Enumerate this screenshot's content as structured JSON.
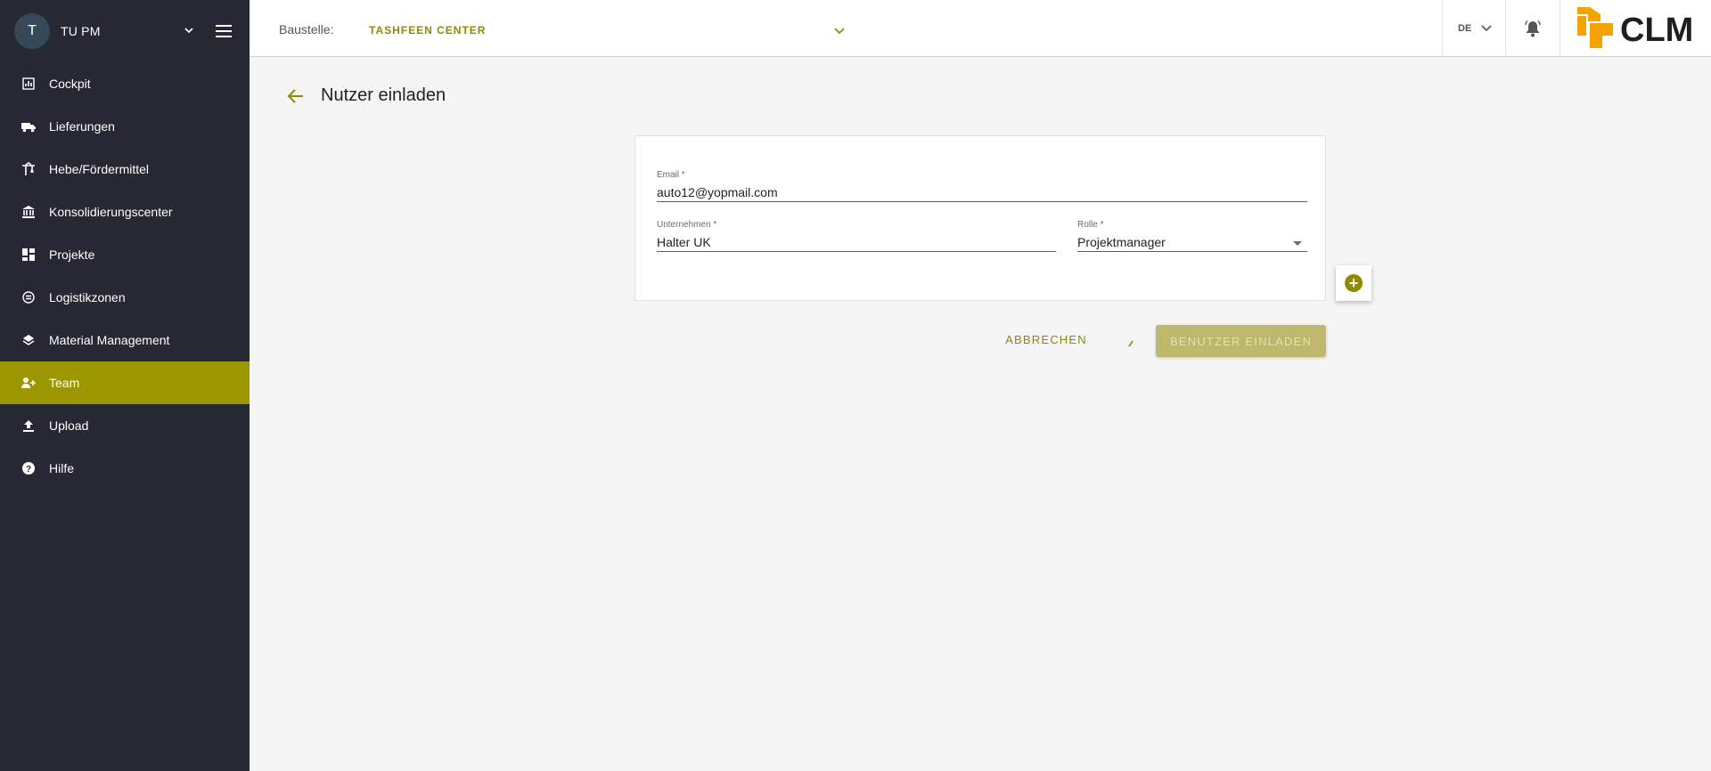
{
  "user": {
    "initial": "T",
    "name": "TU PM"
  },
  "sidebar": {
    "items": [
      {
        "label": "Cockpit",
        "icon": "chart-icon"
      },
      {
        "label": "Lieferungen",
        "icon": "truck-icon"
      },
      {
        "label": "Hebe/Fördermittel",
        "icon": "crane-icon"
      },
      {
        "label": "Konsolidierungscenter",
        "icon": "bank-icon"
      },
      {
        "label": "Projekte",
        "icon": "dashboard-icon"
      },
      {
        "label": "Logistikzonen",
        "icon": "zone-icon"
      },
      {
        "label": "Material Management",
        "icon": "layers-icon"
      },
      {
        "label": "Team",
        "icon": "team-icon",
        "active": true
      },
      {
        "label": "Upload",
        "icon": "upload-icon"
      },
      {
        "label": "Hilfe",
        "icon": "help-icon"
      }
    ],
    "active_color": "#9c9600",
    "background": "#262833"
  },
  "header": {
    "site_label": "Baustelle:",
    "site_value": "TASHFEEN CENTER",
    "language": "DE",
    "logo_text": "CLM"
  },
  "page": {
    "title": "Nutzer einladen"
  },
  "form": {
    "email_label": "Email *",
    "email_value": "auto12@yopmail.com",
    "company_label": "Unternehmen *",
    "company_value": "Halter UK",
    "role_label": "Rolle *",
    "role_value": "Projektmanager"
  },
  "actions": {
    "cancel_label": "ABBRECHEN",
    "invite_label": "BENUTZER EINLADEN"
  },
  "colors": {
    "accent": "#8f8a00",
    "logo_orange": "#f5a300",
    "invite_disabled_bg": "#bdb86b"
  }
}
